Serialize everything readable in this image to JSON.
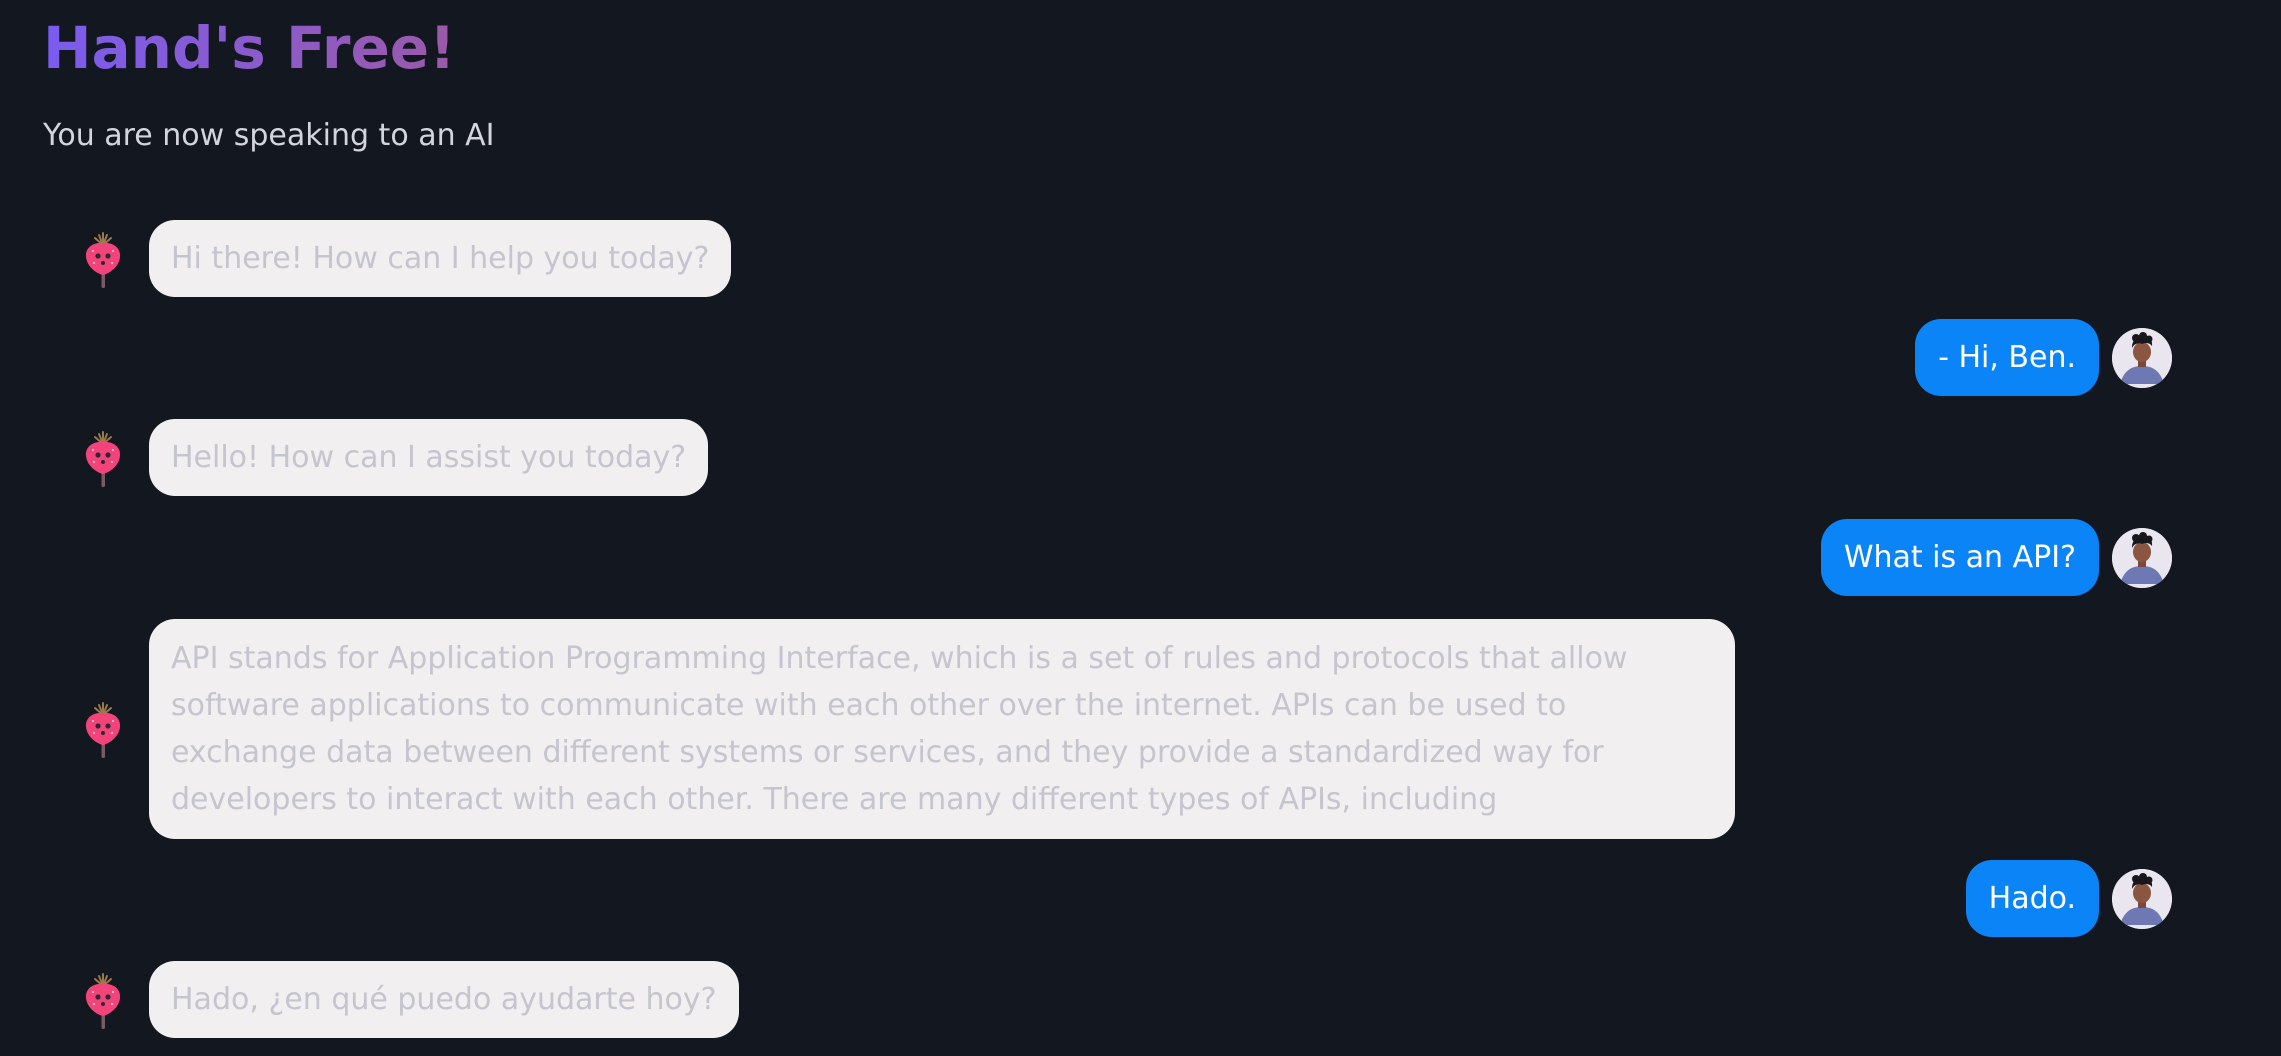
{
  "header": {
    "title": "Hand's Free!",
    "subtitle": "You are now speaking to an AI"
  },
  "colors": {
    "background": "#131720",
    "bot_bubble": "#f1efef",
    "bot_text": "#c5c5cf",
    "user_bubble": "#0a84f7",
    "user_text": "#ffffff",
    "title_gradient_start": "#7b5cf0",
    "title_gradient_end": "#9b5aa8"
  },
  "icons": {
    "bot_avatar": "strawberry-bot-icon",
    "user_avatar": "user-portrait-avatar"
  },
  "messages": [
    {
      "sender": "bot",
      "text": "Hi there! How can I help you today?"
    },
    {
      "sender": "user",
      "text": "- Hi, Ben."
    },
    {
      "sender": "bot",
      "text": "Hello! How can I assist you today?"
    },
    {
      "sender": "user",
      "text": "What is an API?"
    },
    {
      "sender": "bot",
      "text": "API stands for Application Programming Interface, which is a set of rules and protocols that allow software applications to communicate with each other over the internet. APIs can be used to exchange data between different systems or services, and they provide a standardized way for developers to interact with each other. There are many different types of APIs, including"
    },
    {
      "sender": "user",
      "text": "Hado."
    },
    {
      "sender": "bot",
      "text": "Hado, ¿en qué puedo ayudarte hoy?"
    }
  ]
}
